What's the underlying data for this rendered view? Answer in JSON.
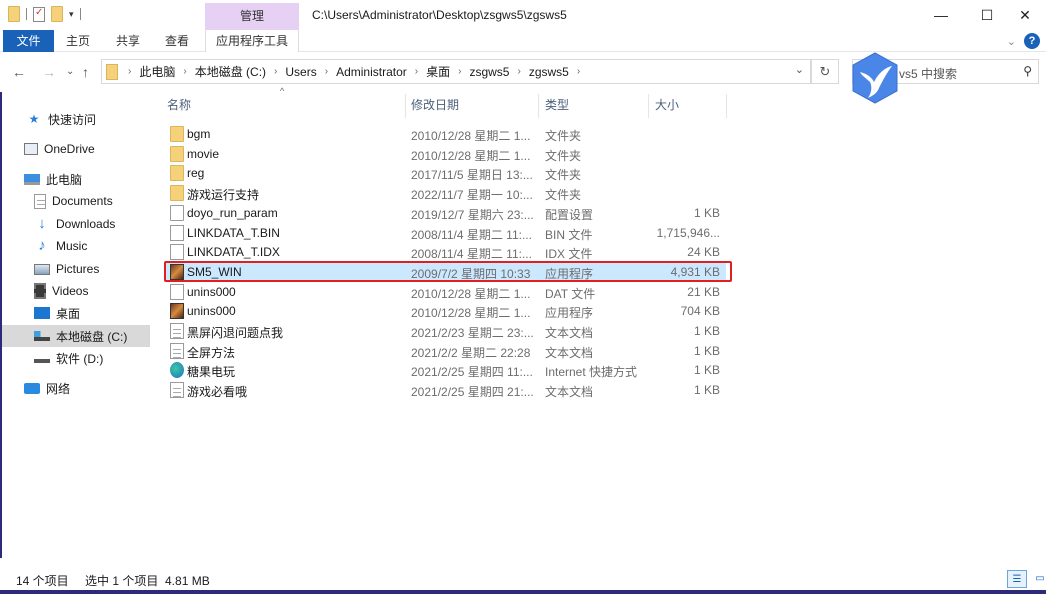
{
  "titlebar": {
    "context_tab": "管理",
    "path": "C:\\Users\\Administrator\\Desktop\\zsgws5\\zgsws5",
    "minimize_icon": "minimize-icon",
    "maximize_icon": "maximize-icon",
    "close_icon": "close-icon"
  },
  "ribbon": {
    "tabs": [
      {
        "label": "文件",
        "active": true
      },
      {
        "label": "主页"
      },
      {
        "label": "共享"
      },
      {
        "label": "查看"
      },
      {
        "label": "应用程序工具"
      }
    ],
    "help_label": "?"
  },
  "nav": {
    "back": "←",
    "forward": "→",
    "recent": "⌄",
    "up": "↑",
    "breadcrumb": [
      "此电脑",
      "本地磁盘 (C:)",
      "Users",
      "Administrator",
      "桌面",
      "zsgws5",
      "zgsws5"
    ],
    "refresh": "↻",
    "search_placeholder": "vs5 中搜索"
  },
  "sidebar": {
    "items": [
      {
        "label": "快速访问",
        "icon": "star-icon"
      },
      {
        "label": "OneDrive",
        "icon": "onedrive-icon"
      },
      {
        "label": "此电脑",
        "icon": "computer-icon"
      },
      {
        "label": "Documents",
        "icon": "documents-icon"
      },
      {
        "label": "Downloads",
        "icon": "downloads-icon"
      },
      {
        "label": "Music",
        "icon": "music-icon"
      },
      {
        "label": "Pictures",
        "icon": "pictures-icon"
      },
      {
        "label": "Videos",
        "icon": "videos-icon"
      },
      {
        "label": "桌面",
        "icon": "desktop-icon"
      },
      {
        "label": "本地磁盘 (C:)",
        "icon": "drive-icon",
        "selected": true
      },
      {
        "label": "软件 (D:)",
        "icon": "drive-icon"
      },
      {
        "label": "网络",
        "icon": "network-icon"
      }
    ]
  },
  "columns": {
    "name": "名称",
    "date": "修改日期",
    "type": "类型",
    "size": "大小"
  },
  "files": [
    {
      "name": "bgm",
      "date": "2010/12/28 星期二 1...",
      "type": "文件夹",
      "size": "",
      "icon": "folder"
    },
    {
      "name": "movie",
      "date": "2010/12/28 星期二 1...",
      "type": "文件夹",
      "size": "",
      "icon": "folder"
    },
    {
      "name": "reg",
      "date": "2017/11/5 星期日 13:...",
      "type": "文件夹",
      "size": "",
      "icon": "folder"
    },
    {
      "name": "游戏运行支持",
      "date": "2022/11/7 星期一 10:...",
      "type": "文件夹",
      "size": "",
      "icon": "folder"
    },
    {
      "name": "doyo_run_param",
      "date": "2019/12/7 星期六 23:...",
      "type": "配置设置",
      "size": "1 KB",
      "icon": "settings"
    },
    {
      "name": "LINKDATA_T.BIN",
      "date": "2008/11/4 星期二 11:...",
      "type": "BIN 文件",
      "size": "1,715,946...",
      "icon": "file"
    },
    {
      "name": "LINKDATA_T.IDX",
      "date": "2008/11/4 星期二 11:...",
      "type": "IDX 文件",
      "size": "24 KB",
      "icon": "file"
    },
    {
      "name": "SM5_WIN",
      "date": "2009/7/2 星期四 10:33",
      "type": "应用程序",
      "size": "4,931 KB",
      "icon": "app",
      "selected": true
    },
    {
      "name": "unins000",
      "date": "2010/12/28 星期二 1...",
      "type": "DAT 文件",
      "size": "21 KB",
      "icon": "file"
    },
    {
      "name": "unins000",
      "date": "2010/12/28 星期二 1...",
      "type": "应用程序",
      "size": "704 KB",
      "icon": "app"
    },
    {
      "name": "黑屏闪退问题点我",
      "date": "2021/2/23 星期二 23:...",
      "type": "文本文档",
      "size": "1 KB",
      "icon": "text"
    },
    {
      "name": "全屏方法",
      "date": "2021/2/2 星期二 22:28",
      "type": "文本文档",
      "size": "1 KB",
      "icon": "text"
    },
    {
      "name": "糖果电玩",
      "date": "2021/2/25 星期四 11:...",
      "type": "Internet 快捷方式",
      "size": "1 KB",
      "icon": "web"
    },
    {
      "name": "游戏必看哦",
      "date": "2021/2/25 星期四 21:...",
      "type": "文本文档",
      "size": "1 KB",
      "icon": "text"
    }
  ],
  "status": {
    "count": "14 个项目",
    "selection": "选中 1 个项目  4.81 MB"
  },
  "colors": {
    "accent": "#1a62b8",
    "context_tab": "#e6d0f4",
    "selection": "#cce8ff",
    "highlight_box": "#e02020"
  }
}
